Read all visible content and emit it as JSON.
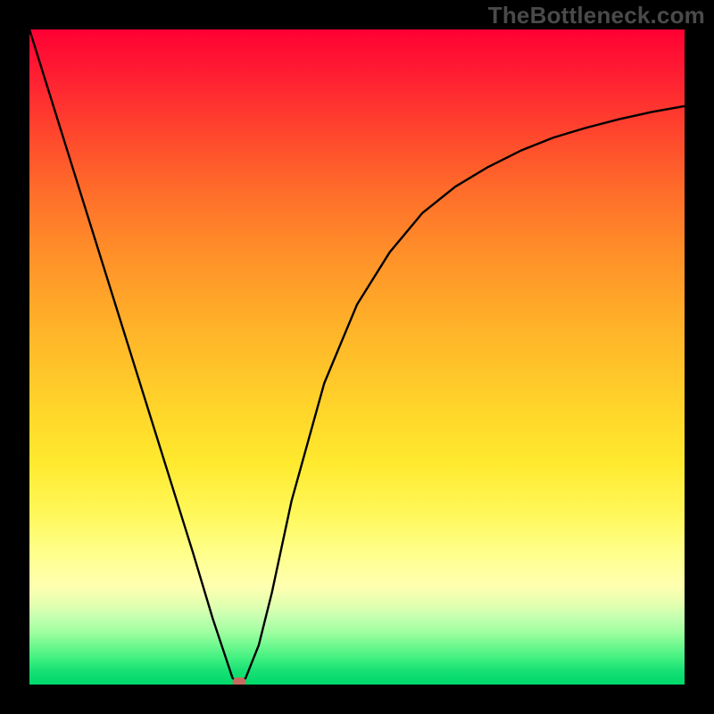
{
  "watermark": "TheBottleneck.com",
  "chart_data": {
    "type": "line",
    "title": "",
    "xlabel": "",
    "ylabel": "",
    "xlim": [
      0,
      100
    ],
    "ylim": [
      0,
      100
    ],
    "x": [
      0,
      5,
      10,
      15,
      20,
      25,
      28,
      30,
      31,
      32,
      33,
      35,
      37,
      40,
      45,
      50,
      55,
      60,
      65,
      70,
      75,
      80,
      85,
      90,
      95,
      100
    ],
    "y": [
      100,
      84,
      68,
      52,
      36,
      20,
      10,
      4,
      1,
      0,
      1,
      6,
      14,
      28,
      46,
      58,
      66,
      72,
      76,
      79,
      81.5,
      83.5,
      85,
      86.3,
      87.4,
      88.3
    ],
    "minimum": {
      "x": 32,
      "y": 0
    },
    "background_gradient": {
      "top": "#ff0033",
      "mid": "#ffd52a",
      "bottom": "#00d86a"
    },
    "annotations": [
      {
        "type": "marker",
        "shape": "pill",
        "color": "#c66a60",
        "x": 32,
        "y": 0
      }
    ]
  }
}
